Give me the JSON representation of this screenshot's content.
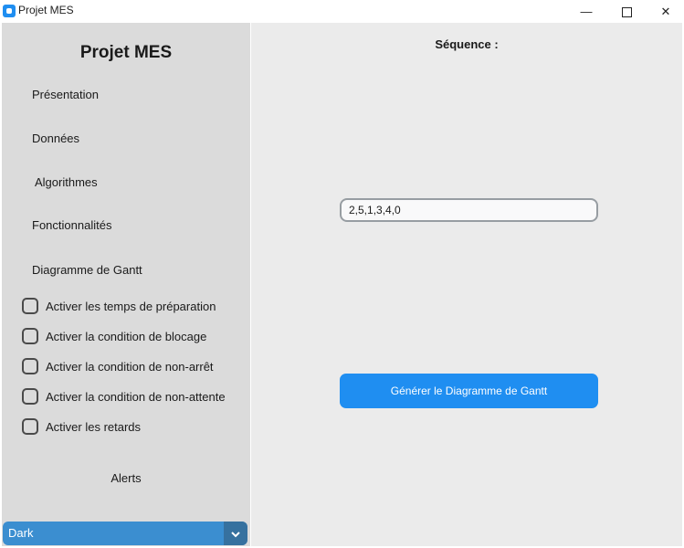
{
  "window": {
    "title": "Projet MES",
    "minimize_glyph": "—",
    "close_glyph": "✕"
  },
  "sidebar": {
    "title": "Projet MES",
    "nav": [
      {
        "label": "Présentation"
      },
      {
        "label": "Données"
      },
      {
        "label": "Algorithmes"
      },
      {
        "label": "Fonctionnalités"
      },
      {
        "label": "Diagramme de Gantt"
      }
    ],
    "options": [
      {
        "label": "Activer les temps de préparation",
        "checked": false
      },
      {
        "label": "Activer la condition de blocage",
        "checked": false
      },
      {
        "label": "Activer la condition de non-arrêt",
        "checked": false
      },
      {
        "label": "Activer la condition de non-attente",
        "checked": false
      },
      {
        "label": "Activer les retards",
        "checked": false
      }
    ],
    "alerts_label": "Alerts",
    "theme": {
      "value": "Dark",
      "arrow_icon": "chevron-down-icon"
    }
  },
  "main": {
    "sequence_label": "Séquence :",
    "sequence_value": "2,5,1,3,4,0",
    "generate_button": "Générer le Diagramme de Gantt"
  },
  "colors": {
    "accent": "#1f8ef1",
    "sidebar_bg": "#dbdbdb",
    "main_bg": "#ebebeb",
    "dropdown_bg": "#3b8ed0",
    "dropdown_arrow_bg": "#36719f"
  }
}
